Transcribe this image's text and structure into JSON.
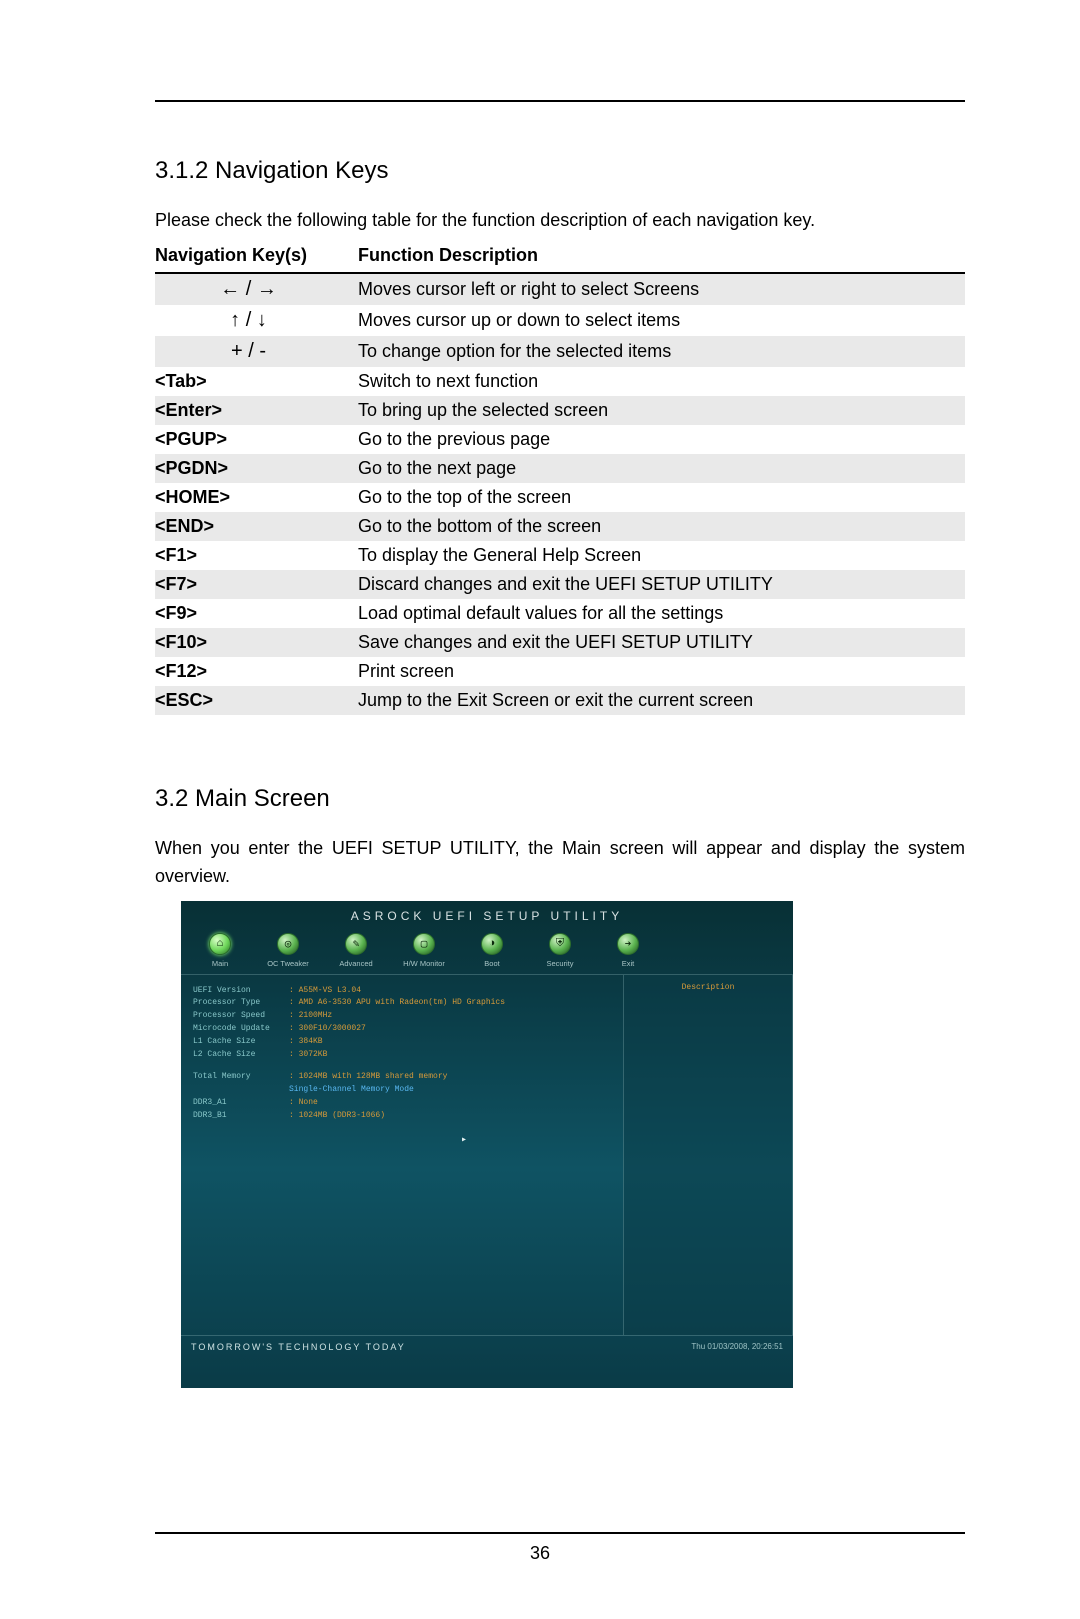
{
  "section1": {
    "heading": "3.1.2  Navigation Keys",
    "para": "Please check the following table for the function description of each navigation key.",
    "table": {
      "head_key": "Navigation Key(s)",
      "head_desc": "Function Description",
      "rows": [
        {
          "key_glyph": "← / →",
          "is_arrow": true,
          "desc": "Moves cursor left or right to select Screens"
        },
        {
          "key_glyph": "↑ / ↓",
          "is_arrow": true,
          "desc": "Moves cursor up or down to select items"
        },
        {
          "key_glyph": "+  /  -",
          "is_arrow": true,
          "desc": "To change option for the selected items"
        },
        {
          "key": "<Tab>",
          "desc": "Switch to next function"
        },
        {
          "key": "<Enter>",
          "desc": "To bring up the selected screen"
        },
        {
          "key": "<PGUP>",
          "desc": "Go to the previous page"
        },
        {
          "key": "<PGDN>",
          "desc": "Go to the next page"
        },
        {
          "key": "<HOME>",
          "desc": "Go to the top of the screen"
        },
        {
          "key": "<END>",
          "desc": "Go to the bottom of the screen"
        },
        {
          "key": "<F1>",
          "desc": "To display the General Help Screen"
        },
        {
          "key": "<F7>",
          "desc": "Discard changes and exit the UEFI SETUP UTILITY"
        },
        {
          "key": "<F9>",
          "desc": "Load optimal default values for all the settings"
        },
        {
          "key": "<F10>",
          "desc": "Save changes and exit the UEFI SETUP UTILITY"
        },
        {
          "key": "<F12>",
          "desc": "Print screen"
        },
        {
          "key": "<ESC>",
          "desc": "Jump to the Exit Screen or exit the current screen"
        }
      ]
    }
  },
  "section2": {
    "heading": "3.2  Main Screen",
    "para": "When you enter the UEFI SETUP UTILITY, the Main screen will appear and display the system overview."
  },
  "uefi": {
    "title": "ASROCK UEFI SETUP UTILITY",
    "tabs": [
      {
        "label": "Main",
        "icon": "⌂",
        "name": "tab-main"
      },
      {
        "label": "OC Tweaker",
        "icon": "◎",
        "name": "tab-oc-tweaker"
      },
      {
        "label": "Advanced",
        "icon": "✎",
        "name": "tab-advanced"
      },
      {
        "label": "H/W Monitor",
        "icon": "▢",
        "name": "tab-hw-monitor"
      },
      {
        "label": "Boot",
        "icon": "◑",
        "name": "tab-boot"
      },
      {
        "label": "Security",
        "icon": "⛨",
        "name": "tab-security"
      },
      {
        "label": "Exit",
        "icon": "➔",
        "name": "tab-exit"
      }
    ],
    "info": [
      {
        "k": "UEFI Version",
        "v": ": A55M-VS L3.04"
      },
      {
        "k": "Processor Type",
        "v": ": AMD A6-3530 APU with Radeon(tm) HD Graphics"
      },
      {
        "k": "Processor Speed",
        "v": ": 2100MHz"
      },
      {
        "k": "Microcode Update",
        "v": ": 300F10/3000027"
      },
      {
        "k": "L1 Cache Size",
        "v": ": 384KB"
      },
      {
        "k": "L2 Cache Size",
        "v": ": 3072KB"
      }
    ],
    "mem": [
      {
        "k": "Total Memory",
        "v": ": 1024MB with 128MB shared memory",
        "cls": "v"
      },
      {
        "k": "",
        "v": "  Single-Channel Memory Mode",
        "cls": "blue"
      },
      {
        "k": "DDR3_A1",
        "v": ": None",
        "cls": "v"
      },
      {
        "k": "DDR3_B1",
        "v": ": 1024MB (DDR3-1066)",
        "cls": "v"
      }
    ],
    "desc_label": "Description",
    "footer_left": "TOMORROW'S TECHNOLOGY TODAY",
    "footer_right": "Thu 01/03/2008, 20:26:51"
  },
  "page_number": "36"
}
